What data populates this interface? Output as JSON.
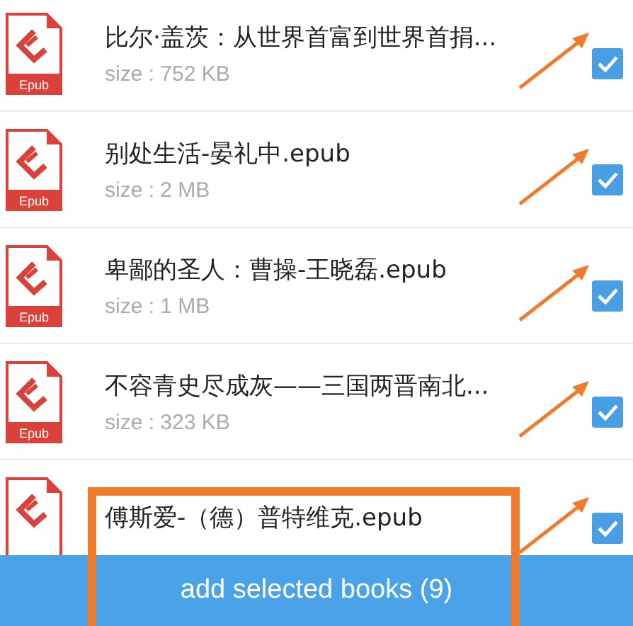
{
  "books": [
    {
      "title": "比尔·盖茨：从世界首富到世界首捐...",
      "size": "size : 752 KB",
      "badge": "Epub",
      "checked": true,
      "marked": true
    },
    {
      "title": "别处生活-晏礼中.epub",
      "size": "size : 2 MB",
      "badge": "Epub",
      "checked": true,
      "marked": true
    },
    {
      "title": "卑鄙的圣人：曹操-王晓磊.epub",
      "size": "size : 1 MB",
      "badge": "Epub",
      "checked": true,
      "marked": true
    },
    {
      "title": "不容青史尽成灰——三国两晋南北...",
      "size": "size : 323 KB",
      "badge": "Epub",
      "checked": true,
      "marked": true
    },
    {
      "title": "傅斯爱-（德）普特维克.epub",
      "checked": true,
      "marked": true
    }
  ],
  "action": {
    "label": "add selected books (9)",
    "highlighted": true
  }
}
